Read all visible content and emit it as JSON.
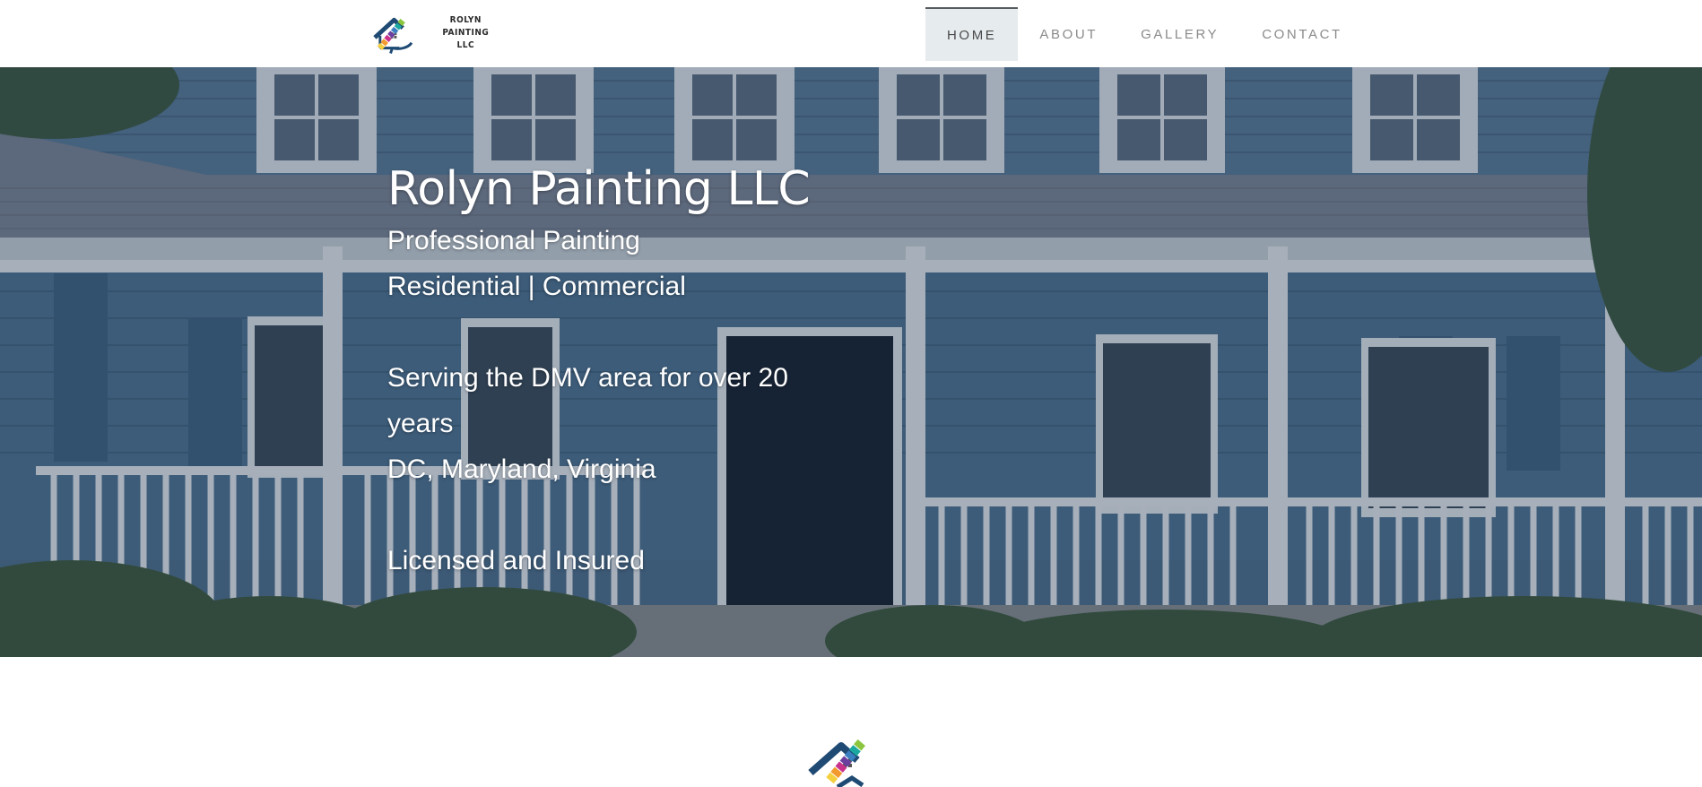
{
  "header": {
    "logo": {
      "line1": "ROLYN",
      "line2": "PAINTING LLC",
      "icon": "house-paint-swatch-logo-icon"
    },
    "nav": [
      {
        "label": "HOME",
        "active": true
      },
      {
        "label": "ABOUT",
        "active": false
      },
      {
        "label": "GALLERY",
        "active": false
      },
      {
        "label": "CONTACT",
        "active": false
      }
    ]
  },
  "hero": {
    "title": "Rolyn Painting LLC",
    "line1": "Professional Painting",
    "line2": "Residential | Commercial",
    "line3a": "Serving the DMV area for over 20",
    "line3b": "years",
    "line4": "DC, Maryland, Virginia",
    "line5": "Licensed and Insured",
    "background": "house-exterior-porch-photo"
  },
  "section": {
    "logo_icon": "house-paint-swatch-logo-icon"
  },
  "colors": {
    "brand_navy": "#1f4a73",
    "nav_active_bg": "#e6ebed",
    "nav_text": "#8a8a8a",
    "swatch_green": "#8cc63f",
    "swatch_teal": "#1aa8a0",
    "swatch_blue": "#3a7fc1",
    "swatch_purple": "#6b3fa0",
    "swatch_magenta": "#c8328c",
    "swatch_orange": "#f29a2e",
    "swatch_yellow": "#f4d03f"
  }
}
